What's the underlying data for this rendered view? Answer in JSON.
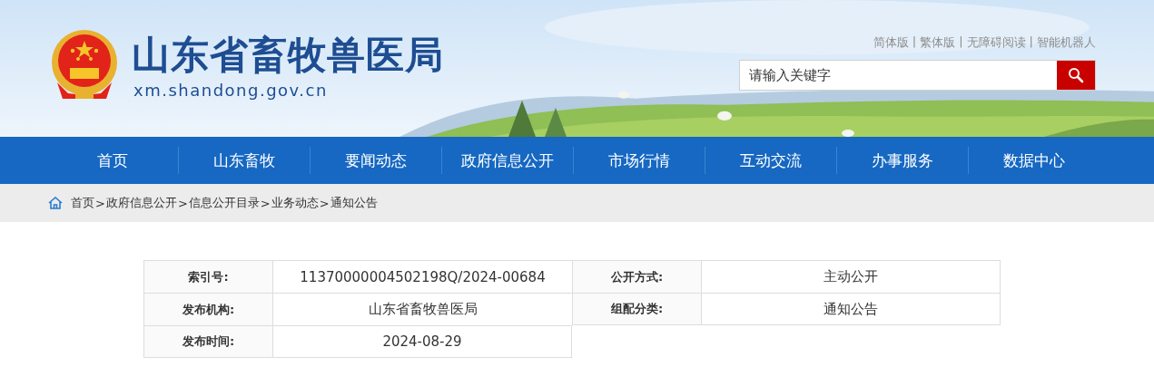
{
  "header": {
    "site_title": "山东省畜牧兽医局",
    "site_url": "xm.shandong.gov.cn",
    "top_links": {
      "separator": "|",
      "items": [
        "简体版",
        "繁体版",
        "无障碍阅读",
        "智能机器人"
      ]
    },
    "search": {
      "placeholder": "请输入关键字"
    }
  },
  "nav": {
    "items": [
      {
        "label": "首页"
      },
      {
        "label": "山东畜牧"
      },
      {
        "label": "要闻动态"
      },
      {
        "label": "政府信息公开"
      },
      {
        "label": "市场行情"
      },
      {
        "label": "互动交流"
      },
      {
        "label": "办事服务"
      },
      {
        "label": "数据中心"
      }
    ]
  },
  "breadcrumb": {
    "separator": ">",
    "items": [
      "首页",
      "政府信息公开",
      "信息公开目录",
      "业务动态",
      "通知公告"
    ]
  },
  "info_table": {
    "rows": [
      [
        {
          "label": "索引号:",
          "value": "11370000004502198Q/2024-00684"
        },
        {
          "label": "公开方式:",
          "value": "主动公开"
        }
      ],
      [
        {
          "label": "发布机构:",
          "value": "山东省畜牧兽医局"
        },
        {
          "label": "组配分类:",
          "value": "通知公告"
        }
      ],
      [
        {
          "label": "发布时间:",
          "value": "2024-08-29"
        }
      ]
    ]
  }
}
